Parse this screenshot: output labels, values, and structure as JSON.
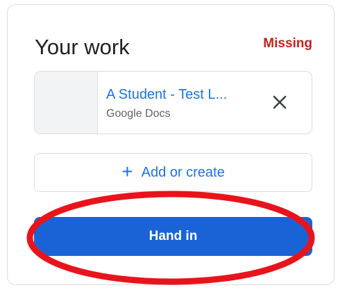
{
  "your_work": {
    "title": "Your work",
    "status": "Missing",
    "status_color": "#c5221f"
  },
  "attachment": {
    "title": "A Student - Test L...",
    "type": "Google Docs",
    "remove_icon": "close-icon"
  },
  "add_button": {
    "icon": "plus-icon",
    "label": "Add or create"
  },
  "hand_in_button": {
    "label": "Hand in",
    "color": "#1a63d6"
  },
  "annotation": {
    "shape": "red-ellipse-highlight",
    "color": "#e8141c"
  }
}
